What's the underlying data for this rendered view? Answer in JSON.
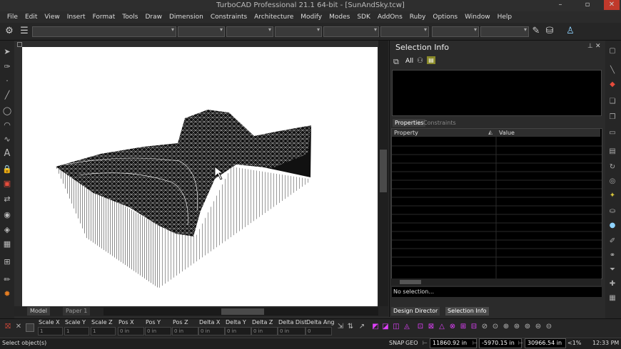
{
  "window": {
    "title": "TurboCAD Professional 21.1 64-bit - [SunAndSky.tcw]"
  },
  "menu": [
    "File",
    "Edit",
    "View",
    "Insert",
    "Format",
    "Tools",
    "Draw",
    "Dimension",
    "Constraints",
    "Architecture",
    "Modify",
    "Modes",
    "SDK",
    "AddOns",
    "Ruby",
    "Options",
    "Window",
    "Help"
  ],
  "tabs": {
    "model": "Model",
    "paper": "Paper 1"
  },
  "selection_panel": {
    "title": "Selection Info",
    "all_label": "All",
    "tab_properties": "Properties",
    "tab_constraints": "Constraints",
    "col_property": "Property",
    "col_value": "Value",
    "status": "No selection..."
  },
  "bottom_tabs": {
    "design_director": "Design Director",
    "selection_info": "Selection Info"
  },
  "inspector_fields": [
    "Scale X",
    "Scale Y",
    "Scale Z",
    "Pos X",
    "Pos Y",
    "Pos Z",
    "Delta X",
    "Delta Y",
    "Delta Z",
    "Delta Dist",
    "Delta Ang"
  ],
  "inspector_values": [
    "1",
    "1",
    "1",
    "0 in",
    "0 in",
    "0 in",
    "0 in",
    "0 in",
    "0 in",
    "0 in",
    "0"
  ],
  "status": {
    "prompt": "Select object(s)",
    "snap": "SNAP",
    "geo": "GEO",
    "x": "11860.92 in",
    "y": "-5970.15 in",
    "z": "30966.54 in",
    "zoom": "<1%",
    "time": "12:33 PM"
  },
  "colors": {
    "accent": "#8fd3ff",
    "panel_bg": "#2b2b2b",
    "canvas_bg": "#ffffff"
  }
}
